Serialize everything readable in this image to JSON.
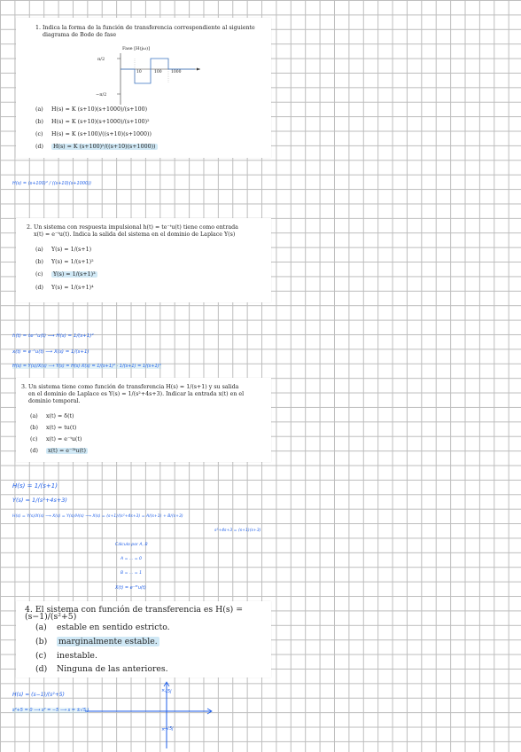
{
  "q1": {
    "title_line1": "1. Indica la forma de la función de transferencia correspondiente al siguiente",
    "title_line2": "diagrama de Bode de fase",
    "plot": {
      "title": "Fase [H(jω)]",
      "y_top": "π/2",
      "y_bottom": "−π/2",
      "x_ticks": [
        "10",
        "100",
        "1000"
      ]
    },
    "options": [
      {
        "label": "(a)",
        "text": "H(s) = K (s+10)(s+1000)/(s+100)",
        "selected": false
      },
      {
        "label": "(b)",
        "text": "H(s) = K (s+10)(s+1000)/(s+100)²",
        "selected": false
      },
      {
        "label": "(c)",
        "text": "H(s) = K (s+100)/((s+10)(s+1000))",
        "selected": false
      },
      {
        "label": "(d)",
        "text": "H(s) = K (s+100)²/((s+10)(s+1000))",
        "selected": true
      }
    ],
    "handwriting": "H(s) = (s+100)² / ((s+10)(s+1000))"
  },
  "q2": {
    "title_line1": "2. Un sistema con respuesta impulsional h(t) = te⁻ᵗu(t) tiene como entrada",
    "title_line2": "x(t) = e⁻ᵗu(t). Indica la salida del sistema en el dominio de Laplace Y(s)",
    "options": [
      {
        "label": "(a)",
        "text": "Y(s) = 1/(s+1)",
        "selected": false
      },
      {
        "label": "(b)",
        "text": "Y(s) = 1/(s+1)²",
        "selected": false
      },
      {
        "label": "(c)",
        "text": "Y(s) = 1/(s+1)³",
        "selected": true
      },
      {
        "label": "(d)",
        "text": "Y(s) = 1/(s+1)⁴",
        "selected": false
      }
    ],
    "handwriting": {
      "line1": "h(t) = te⁻ᵗu(t) ⟶ H(s) = 1/(s+1)²",
      "line2": "x(t) = e⁻ᵗu(t) ⟶ X(s) = 1/(s+1)",
      "line3": "H(s) = Y(s)/X(s) ⟶ Y(s) = H(s)·X(s) = 1/(s+1)² · 1/(s+1) = 1/(s+1)³"
    }
  },
  "q3": {
    "title_line1": "3. Un sistema tiene como función de transferencia H(s) = 1/(s+1) y su salida",
    "title_line2": "en el dominio de Laplace es Y(s) = 1/(s²+4s+3). Indicar la entrada x(t) en el",
    "title_line3": "dominio temporal.",
    "options": [
      {
        "label": "(a)",
        "text": "x(t) = δ(t)",
        "selected": false
      },
      {
        "label": "(b)",
        "text": "x(t) = tu(t)",
        "selected": false
      },
      {
        "label": "(c)",
        "text": "x(t) = e⁻ᵗu(t)",
        "selected": false
      },
      {
        "label": "(d)",
        "text": "x(t) = e⁻³ᵗu(t)",
        "selected": true
      }
    ],
    "handwriting": {
      "line1": "H(s) = 1/(s+1)",
      "line2": "Y(s) = 1/(s²+4s+3)",
      "line3": "H(s) = Y(s)/X(s) ⟶ X(s) = Y(s)/H(s) ⟶ X(s) = (s+1)/(s²+4s+3) = A/(s+1) + B/(s+3)",
      "line4": "s²+4s+3 = (s+1)(s+3)",
      "line5": "Cálculo por A, B",
      "line6": "A = ... = 0",
      "line7": "B = ... = 1",
      "line8": "X(t) = e⁻³ᵗu(t)"
    }
  },
  "q4": {
    "title": "4. El sistema con función de transferencia es H(s) = (s−1)/(s²+5)",
    "options": [
      {
        "label": "(a)",
        "text": "estable en sentido estricto.",
        "selected": false
      },
      {
        "label": "(b)",
        "text": "marginalmente estable.",
        "selected": true
      },
      {
        "label": "(c)",
        "text": "inestable.",
        "selected": false
      },
      {
        "label": "(d)",
        "text": "Ninguna de las anteriores.",
        "selected": false
      }
    ],
    "handwriting": {
      "line1": "H(s) = (s−1)/(s²+5)",
      "line2": "s²+5 = 0 ⟶ s² = −5 ⟶ s = ±√5 j",
      "pole_top": "√5j",
      "pole_bottom": "−√5j"
    }
  },
  "colors": {
    "ink": "#1e5ee8",
    "highlight": "#aad6ec",
    "grid": "#bdbdbd"
  }
}
